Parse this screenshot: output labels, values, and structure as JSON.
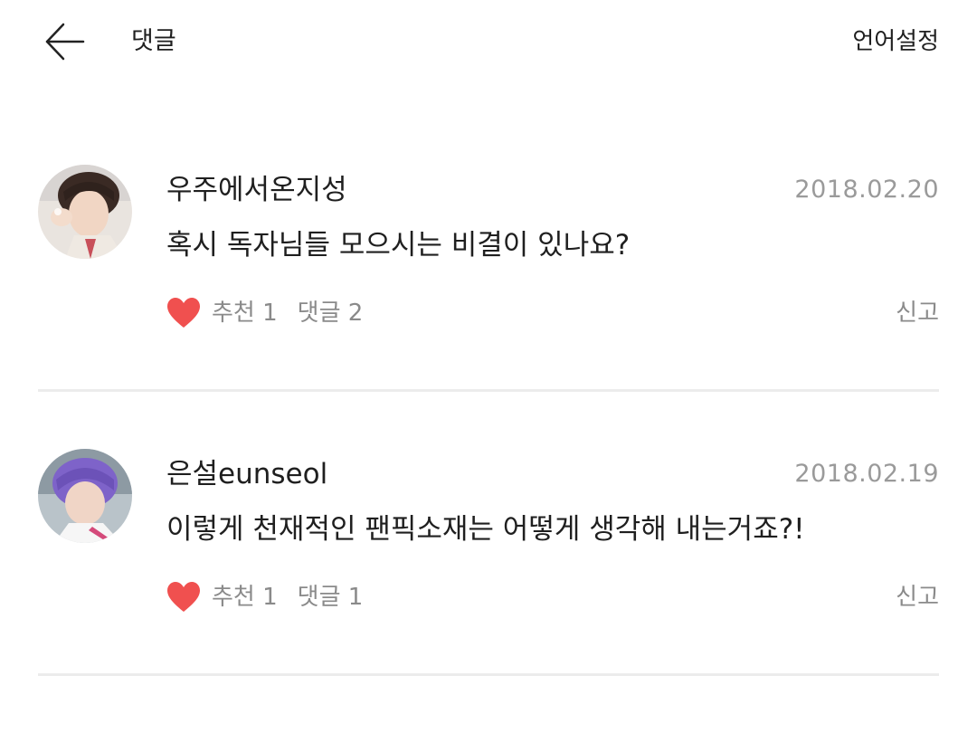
{
  "header": {
    "title": "댓글",
    "language_setting": "언어설정"
  },
  "comments": [
    {
      "author": "우주에서온지성",
      "date": "2018.02.20",
      "text": "혹시 독자님들 모으시는 비결이 있나요?",
      "like_label": "추천 1",
      "reply_label": "댓글 2",
      "report_label": "신고"
    },
    {
      "author": "은설eunseol",
      "date": "2018.02.19",
      "text": "이렇게 천재적인 팬픽소재는 어떻게 생각해 내는거죠?!",
      "like_label": "추천 1",
      "reply_label": "댓글 1",
      "report_label": "신고"
    }
  ],
  "colors": {
    "heart": "#f0504f",
    "date": "#9a9a9a",
    "meta": "#8a8a8a",
    "divider": "#ececec"
  },
  "icons": {
    "back": "arrow-left-icon",
    "like": "heart-icon"
  }
}
